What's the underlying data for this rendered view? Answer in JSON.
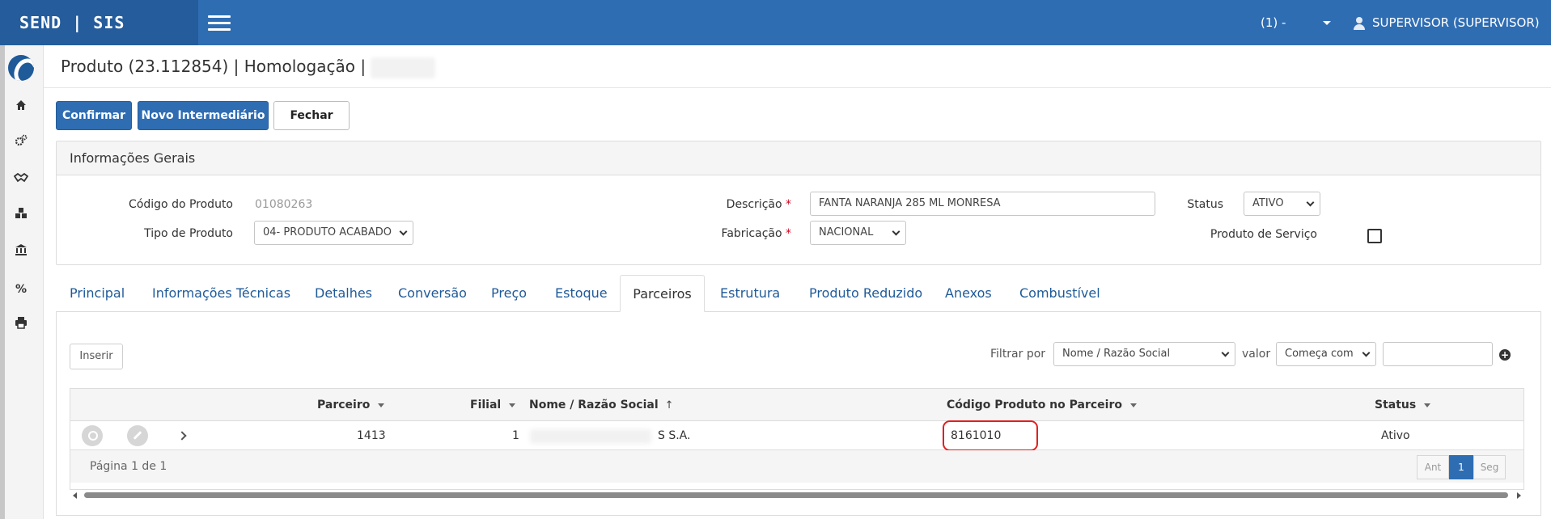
{
  "topbar": {
    "brand": "SEND | SIS",
    "environment": "(1) -",
    "user": "SUPERVISOR (SUPERVISOR)"
  },
  "sidebar": {
    "icons": [
      "home-icon",
      "cogs-icon",
      "handshake-icon",
      "cubes-icon",
      "bank-icon",
      "percent-icon",
      "print-icon"
    ]
  },
  "page": {
    "title": "Produto (23.112854) | Homologação |"
  },
  "toolbar": {
    "confirm": "Confirmar",
    "new_intermediary": "Novo Intermediário",
    "close": "Fechar"
  },
  "general_info": {
    "heading": "Informações Gerais",
    "product_code_label": "Código do Produto",
    "product_code_value": "01080263",
    "product_type_label": "Tipo de Produto",
    "product_type_value": "04- PRODUTO ACABADO",
    "description_label": "Descrição",
    "description_value": "FANTA NARANJA 285 ML MONRESA",
    "manufacturing_label": "Fabricação",
    "manufacturing_value": "NACIONAL",
    "status_label": "Status",
    "status_value": "ATIVO",
    "service_product_label": "Produto de Serviço",
    "required_marker": "*"
  },
  "tabs": [
    {
      "label": "Principal"
    },
    {
      "label": "Informações Técnicas"
    },
    {
      "label": "Detalhes"
    },
    {
      "label": "Conversão"
    },
    {
      "label": "Preço"
    },
    {
      "label": "Estoque"
    },
    {
      "label": "Parceiros"
    },
    {
      "label": "Estrutura"
    },
    {
      "label": "Produto Reduzido"
    },
    {
      "label": "Anexos"
    },
    {
      "label": "Combustível"
    }
  ],
  "partners": {
    "insert_button": "Inserir",
    "filter_by_label": "Filtrar por",
    "filter_field": "Nome / Razão Social",
    "value_label": "valor",
    "filter_operator": "Começa com",
    "filter_value": "",
    "columns": {
      "partner": "Parceiro",
      "branch": "Filial",
      "name": "Nome / Razão Social",
      "partner_code": "Código Produto no Parceiro",
      "status": "Status"
    },
    "rows": [
      {
        "partner": "1413",
        "branch": "1",
        "name": "S S.A.",
        "partner_code": "8161010",
        "status": "Ativo"
      }
    ],
    "pagination": {
      "summary": "Página 1 de 1",
      "prev": "Ant",
      "current": "1",
      "next": "Seg"
    }
  }
}
